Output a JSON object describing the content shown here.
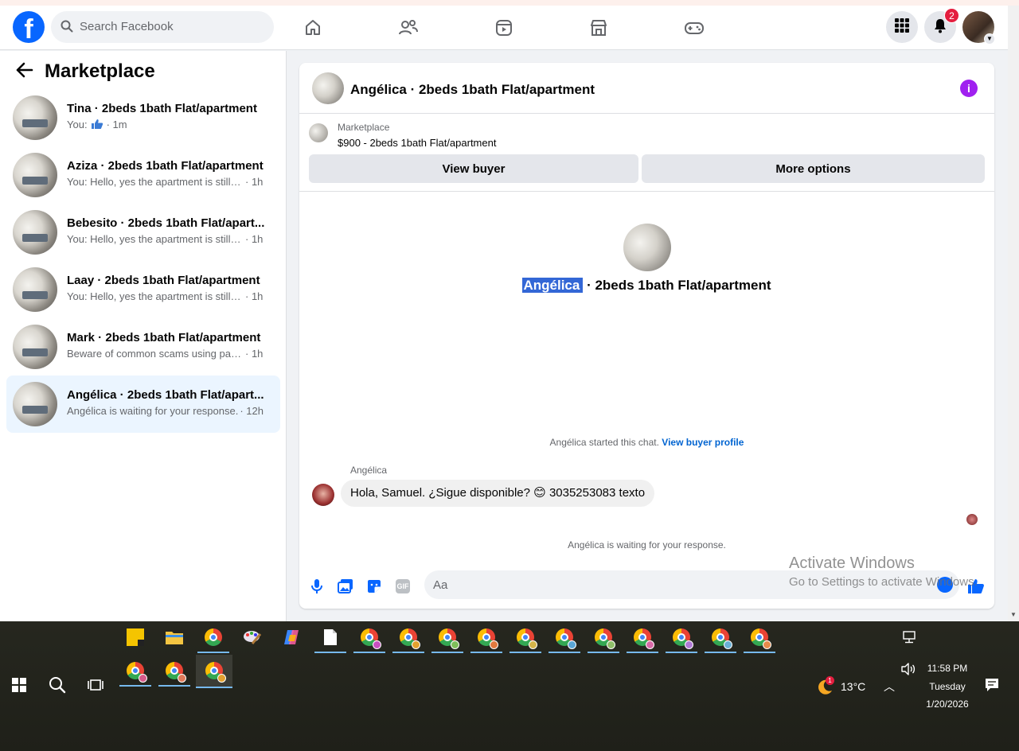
{
  "topbar": {
    "logo": "facebook-logo",
    "search_placeholder": "Search Facebook",
    "notification_count": "2",
    "nav_icons": [
      "home-icon",
      "friends-icon",
      "watch-icon",
      "marketplace-icon",
      "gaming-icon"
    ]
  },
  "sidebar": {
    "title": "Marketplace",
    "conversations": [
      {
        "name": "Tina · 2beds 1bath Flat/apartment",
        "snippet": "You:",
        "has_like": true,
        "time": "· 1m",
        "active": false
      },
      {
        "name": "Aziza · 2beds 1bath Flat/apartment",
        "snippet": "You: Hello, yes the apartment is still a...",
        "time": "· 1h",
        "active": false
      },
      {
        "name": "Bebesito · 2beds 1bath Flat/apart...",
        "snippet": "You: Hello, yes the apartment is still a...",
        "time": "· 1h",
        "active": false
      },
      {
        "name": "Laay · 2beds 1bath Flat/apartment",
        "snippet": "You: Hello, yes the apartment is still a...",
        "time": "· 1h",
        "active": false
      },
      {
        "name": "Mark · 2beds 1bath Flat/apartment",
        "snippet": "Beware of common scams using pay...",
        "time": "· 1h",
        "active": false
      },
      {
        "name": "Angélica · 2beds 1bath Flat/apart...",
        "snippet": "Angélica is waiting for your response.",
        "time": "· 12h",
        "active": true
      }
    ]
  },
  "chat": {
    "header_title": "Angélica · 2beds 1bath Flat/apartment",
    "marketplace_label": "Marketplace",
    "listing": "$900 - 2beds 1bath Flat/apartment",
    "view_buyer": "View buyer",
    "more_options": "More options",
    "center_name": "Angélica",
    "center_rest": " · 2beds 1bath Flat/apartment",
    "started_text": "Angélica started this chat.",
    "buyer_profile_link": "View buyer profile",
    "sender_name": "Angélica",
    "message": "Hola, Samuel. ¿Sigue disponible? 😊 3035253083 texto",
    "waiting": "Angélica is waiting for your response.",
    "input_placeholder": "Aa"
  },
  "watermark": {
    "line1": "Activate Windows",
    "line2": "Go to Settings to activate Windows."
  },
  "taskbar": {
    "weather_temp": "13°C",
    "weather_badge": "1",
    "time": "11:58 PM",
    "day": "Tuesday",
    "date": "1/20/2026",
    "accent": "#76b9ed"
  }
}
